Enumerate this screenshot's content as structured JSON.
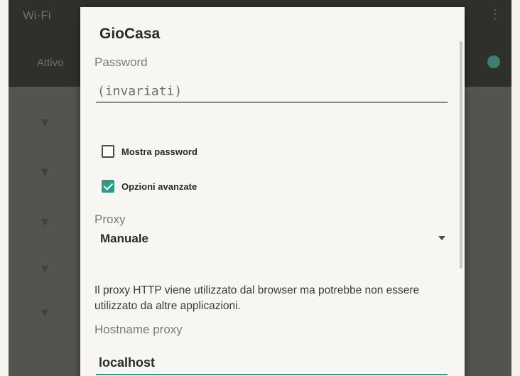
{
  "background": {
    "appbar_title": "Wi-Fi",
    "appbar_toggle": "Attivo",
    "menu_glyph": "⋮",
    "row_icon": "wifi-icon"
  },
  "dialog": {
    "title": "GioCasa",
    "password": {
      "label": "Password",
      "value": "(invariati)"
    },
    "show_password": {
      "label": "Mostra password",
      "checked": false
    },
    "advanced_options": {
      "label": "Opzioni avanzate",
      "checked": true
    },
    "proxy": {
      "label": "Proxy",
      "value": "Manuale"
    },
    "proxy_info": "Il proxy HTTP viene utilizzato dal browser ma potrebbe non essere utilizzato da altre applicazioni.",
    "hostname": {
      "label": "Hostname proxy",
      "value": "localhost"
    }
  },
  "colors": {
    "accent": "#2f9a88",
    "dialog_bg": "#f7f6f3",
    "dim_bg": "#52554f",
    "appbar_bg": "#2e302c"
  }
}
